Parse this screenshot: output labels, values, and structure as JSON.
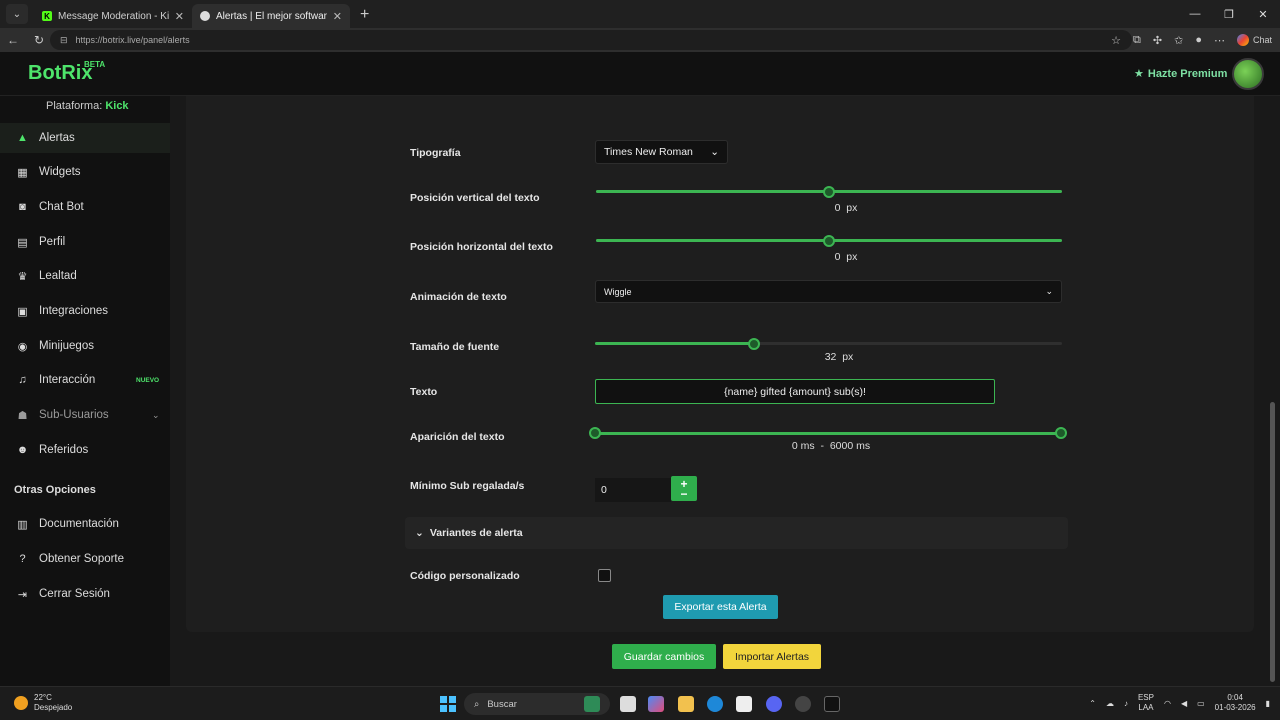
{
  "browser": {
    "tabs": [
      {
        "title": "Message Moderation - Kick Dashb",
        "close": "✕"
      },
      {
        "title": "Alertas | El mejor software para pe",
        "close": "✕"
      }
    ],
    "new_tab": "+",
    "url": "https://botrix.live/panel/alerts",
    "chat_label": "Chat"
  },
  "header": {
    "logo": "BotRix",
    "beta": "BETA",
    "premium": "Hazte Premium"
  },
  "sidebar": {
    "platform_label": "Plataforma:",
    "platform_value": "Kick",
    "items": [
      {
        "label": "Alertas",
        "icon": "warning-icon"
      },
      {
        "label": "Widgets",
        "icon": "grid-icon"
      },
      {
        "label": "Chat Bot",
        "icon": "robot-icon"
      },
      {
        "label": "Perfil",
        "icon": "id-card-icon"
      },
      {
        "label": "Lealtad",
        "icon": "trophy-icon"
      },
      {
        "label": "Integraciones",
        "icon": "plug-icon"
      },
      {
        "label": "Minijuegos",
        "icon": "gamepad-icon"
      },
      {
        "label": "Interacción",
        "icon": "music-icon",
        "badge": "NUEVO"
      },
      {
        "label": "Sub-Usuarios",
        "icon": "users-icon"
      },
      {
        "label": "Referidos",
        "icon": "user-plus-icon"
      }
    ],
    "other_heading": "Otras Opciones",
    "other_items": [
      {
        "label": "Documentación",
        "icon": "book-icon"
      },
      {
        "label": "Obtener Soporte",
        "icon": "help-icon"
      },
      {
        "label": "Cerrar Sesión",
        "icon": "logout-icon"
      }
    ]
  },
  "form": {
    "typography": {
      "label": "Tipografía",
      "value": "Times New Roman"
    },
    "vertical_pos": {
      "label": "Posición vertical del texto",
      "value": "0",
      "unit": "px",
      "fraction": 0.5
    },
    "horizontal_pos": {
      "label": "Posición horizontal del texto",
      "value": "0",
      "unit": "px",
      "fraction": 0.5
    },
    "animation": {
      "label": "Animación de texto",
      "value": "Wiggle"
    },
    "font_size": {
      "label": "Tamaño de fuente",
      "value": "32",
      "unit": "px",
      "fraction": 0.34
    },
    "text": {
      "label": "Texto",
      "value": "{name} gifted {amount} sub(s)!"
    },
    "appearance": {
      "label": "Aparición del texto",
      "min": "0",
      "max": "6000",
      "unit": "ms",
      "sep": "-"
    },
    "min_subs": {
      "label": "Mínimo Sub regalada/s",
      "value": "0"
    },
    "variants": {
      "label": "Variantes de alerta"
    },
    "custom_code": {
      "label": "Código personalizado",
      "checked": false
    },
    "export_btn": "Exportar esta Alerta"
  },
  "footer": {
    "save_btn": "Guardar cambios",
    "import_btn": "Importar Alertas"
  },
  "taskbar": {
    "weather_temp": "22°C",
    "weather_desc": "Despejado",
    "search": "Buscar",
    "lang1": "ESP",
    "lang2": "LAA",
    "time": "0:04",
    "date": "01-03-2026"
  },
  "colors": {
    "accent": "#3cb552",
    "export": "#1f9bb0",
    "import": "#f2d53c"
  }
}
